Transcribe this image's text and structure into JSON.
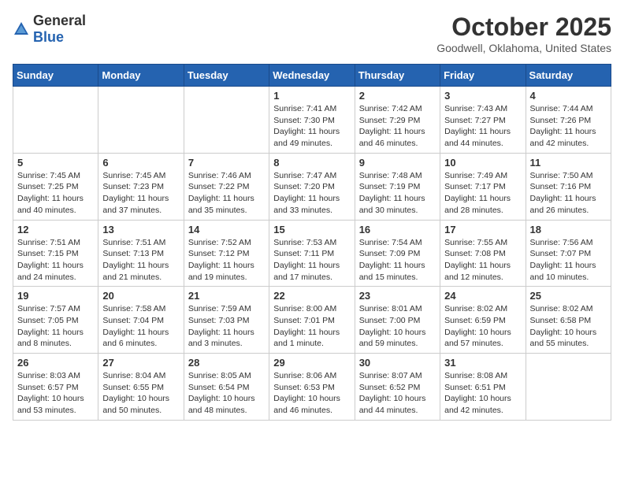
{
  "logo": {
    "text_general": "General",
    "text_blue": "Blue"
  },
  "header": {
    "month": "October 2025",
    "location": "Goodwell, Oklahoma, United States"
  },
  "days_of_week": [
    "Sunday",
    "Monday",
    "Tuesday",
    "Wednesday",
    "Thursday",
    "Friday",
    "Saturday"
  ],
  "weeks": [
    [
      {
        "day": "",
        "info": ""
      },
      {
        "day": "",
        "info": ""
      },
      {
        "day": "",
        "info": ""
      },
      {
        "day": "1",
        "info": "Sunrise: 7:41 AM\nSunset: 7:30 PM\nDaylight: 11 hours and 49 minutes."
      },
      {
        "day": "2",
        "info": "Sunrise: 7:42 AM\nSunset: 7:29 PM\nDaylight: 11 hours and 46 minutes."
      },
      {
        "day": "3",
        "info": "Sunrise: 7:43 AM\nSunset: 7:27 PM\nDaylight: 11 hours and 44 minutes."
      },
      {
        "day": "4",
        "info": "Sunrise: 7:44 AM\nSunset: 7:26 PM\nDaylight: 11 hours and 42 minutes."
      }
    ],
    [
      {
        "day": "5",
        "info": "Sunrise: 7:45 AM\nSunset: 7:25 PM\nDaylight: 11 hours and 40 minutes."
      },
      {
        "day": "6",
        "info": "Sunrise: 7:45 AM\nSunset: 7:23 PM\nDaylight: 11 hours and 37 minutes."
      },
      {
        "day": "7",
        "info": "Sunrise: 7:46 AM\nSunset: 7:22 PM\nDaylight: 11 hours and 35 minutes."
      },
      {
        "day": "8",
        "info": "Sunrise: 7:47 AM\nSunset: 7:20 PM\nDaylight: 11 hours and 33 minutes."
      },
      {
        "day": "9",
        "info": "Sunrise: 7:48 AM\nSunset: 7:19 PM\nDaylight: 11 hours and 30 minutes."
      },
      {
        "day": "10",
        "info": "Sunrise: 7:49 AM\nSunset: 7:17 PM\nDaylight: 11 hours and 28 minutes."
      },
      {
        "day": "11",
        "info": "Sunrise: 7:50 AM\nSunset: 7:16 PM\nDaylight: 11 hours and 26 minutes."
      }
    ],
    [
      {
        "day": "12",
        "info": "Sunrise: 7:51 AM\nSunset: 7:15 PM\nDaylight: 11 hours and 24 minutes."
      },
      {
        "day": "13",
        "info": "Sunrise: 7:51 AM\nSunset: 7:13 PM\nDaylight: 11 hours and 21 minutes."
      },
      {
        "day": "14",
        "info": "Sunrise: 7:52 AM\nSunset: 7:12 PM\nDaylight: 11 hours and 19 minutes."
      },
      {
        "day": "15",
        "info": "Sunrise: 7:53 AM\nSunset: 7:11 PM\nDaylight: 11 hours and 17 minutes."
      },
      {
        "day": "16",
        "info": "Sunrise: 7:54 AM\nSunset: 7:09 PM\nDaylight: 11 hours and 15 minutes."
      },
      {
        "day": "17",
        "info": "Sunrise: 7:55 AM\nSunset: 7:08 PM\nDaylight: 11 hours and 12 minutes."
      },
      {
        "day": "18",
        "info": "Sunrise: 7:56 AM\nSunset: 7:07 PM\nDaylight: 11 hours and 10 minutes."
      }
    ],
    [
      {
        "day": "19",
        "info": "Sunrise: 7:57 AM\nSunset: 7:05 PM\nDaylight: 11 hours and 8 minutes."
      },
      {
        "day": "20",
        "info": "Sunrise: 7:58 AM\nSunset: 7:04 PM\nDaylight: 11 hours and 6 minutes."
      },
      {
        "day": "21",
        "info": "Sunrise: 7:59 AM\nSunset: 7:03 PM\nDaylight: 11 hours and 3 minutes."
      },
      {
        "day": "22",
        "info": "Sunrise: 8:00 AM\nSunset: 7:01 PM\nDaylight: 11 hours and 1 minute."
      },
      {
        "day": "23",
        "info": "Sunrise: 8:01 AM\nSunset: 7:00 PM\nDaylight: 10 hours and 59 minutes."
      },
      {
        "day": "24",
        "info": "Sunrise: 8:02 AM\nSunset: 6:59 PM\nDaylight: 10 hours and 57 minutes."
      },
      {
        "day": "25",
        "info": "Sunrise: 8:02 AM\nSunset: 6:58 PM\nDaylight: 10 hours and 55 minutes."
      }
    ],
    [
      {
        "day": "26",
        "info": "Sunrise: 8:03 AM\nSunset: 6:57 PM\nDaylight: 10 hours and 53 minutes."
      },
      {
        "day": "27",
        "info": "Sunrise: 8:04 AM\nSunset: 6:55 PM\nDaylight: 10 hours and 50 minutes."
      },
      {
        "day": "28",
        "info": "Sunrise: 8:05 AM\nSunset: 6:54 PM\nDaylight: 10 hours and 48 minutes."
      },
      {
        "day": "29",
        "info": "Sunrise: 8:06 AM\nSunset: 6:53 PM\nDaylight: 10 hours and 46 minutes."
      },
      {
        "day": "30",
        "info": "Sunrise: 8:07 AM\nSunset: 6:52 PM\nDaylight: 10 hours and 44 minutes."
      },
      {
        "day": "31",
        "info": "Sunrise: 8:08 AM\nSunset: 6:51 PM\nDaylight: 10 hours and 42 minutes."
      },
      {
        "day": "",
        "info": ""
      }
    ]
  ]
}
